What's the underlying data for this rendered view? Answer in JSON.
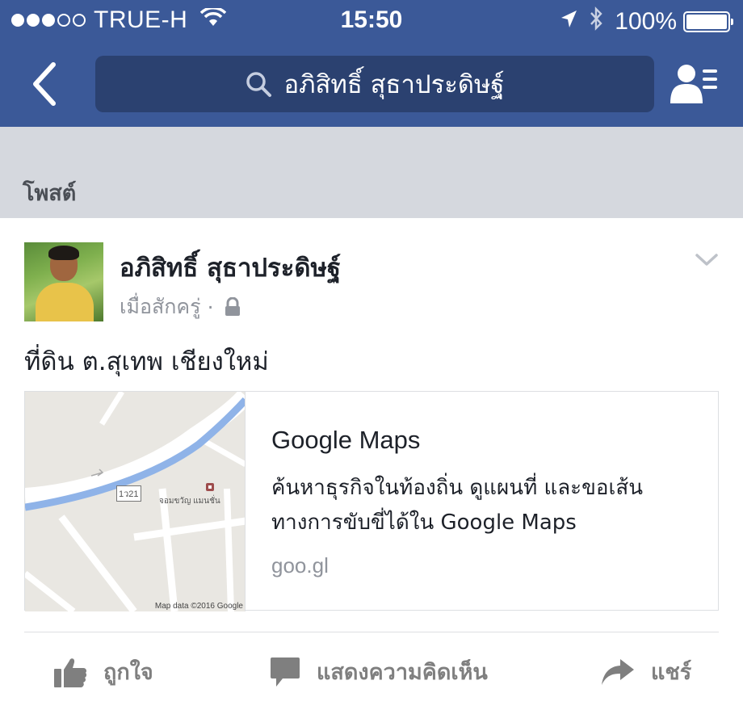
{
  "status_bar": {
    "carrier": "TRUE-H",
    "time": "15:50",
    "battery": "100%"
  },
  "nav": {
    "search_text": "อภิสิทธิ์ สุธาประดิษฐ์"
  },
  "section": {
    "title": "โพสต์"
  },
  "post": {
    "author": "อภิสิทธิ์ สุธาประดิษฐ์",
    "time": "เมื่อสักครู่",
    "separator": "·",
    "text": "ที่ดิน ต.สุเทพ เชียงใหม่",
    "link": {
      "title": "Google Maps",
      "description": "ค้นหาธุรกิจในท้องถิ่น ดูแผนที่ และขอเส้นทางการขับขี่ได้ใน Google Maps",
      "domain": "goo.gl",
      "map": {
        "road_label": "1ว21",
        "place_label": "จอมขวัญ แมนชั่น",
        "attribution": "Map data ©2016 Google"
      }
    }
  },
  "actions": {
    "like": "ถูกใจ",
    "comment": "แสดงความคิดเห็น",
    "share": "แชร์"
  },
  "colors": {
    "facebook_blue": "#3b5998",
    "search_box": "#2b4170",
    "section_bg": "#d5d8de",
    "action_gray": "#7f7f7f"
  }
}
